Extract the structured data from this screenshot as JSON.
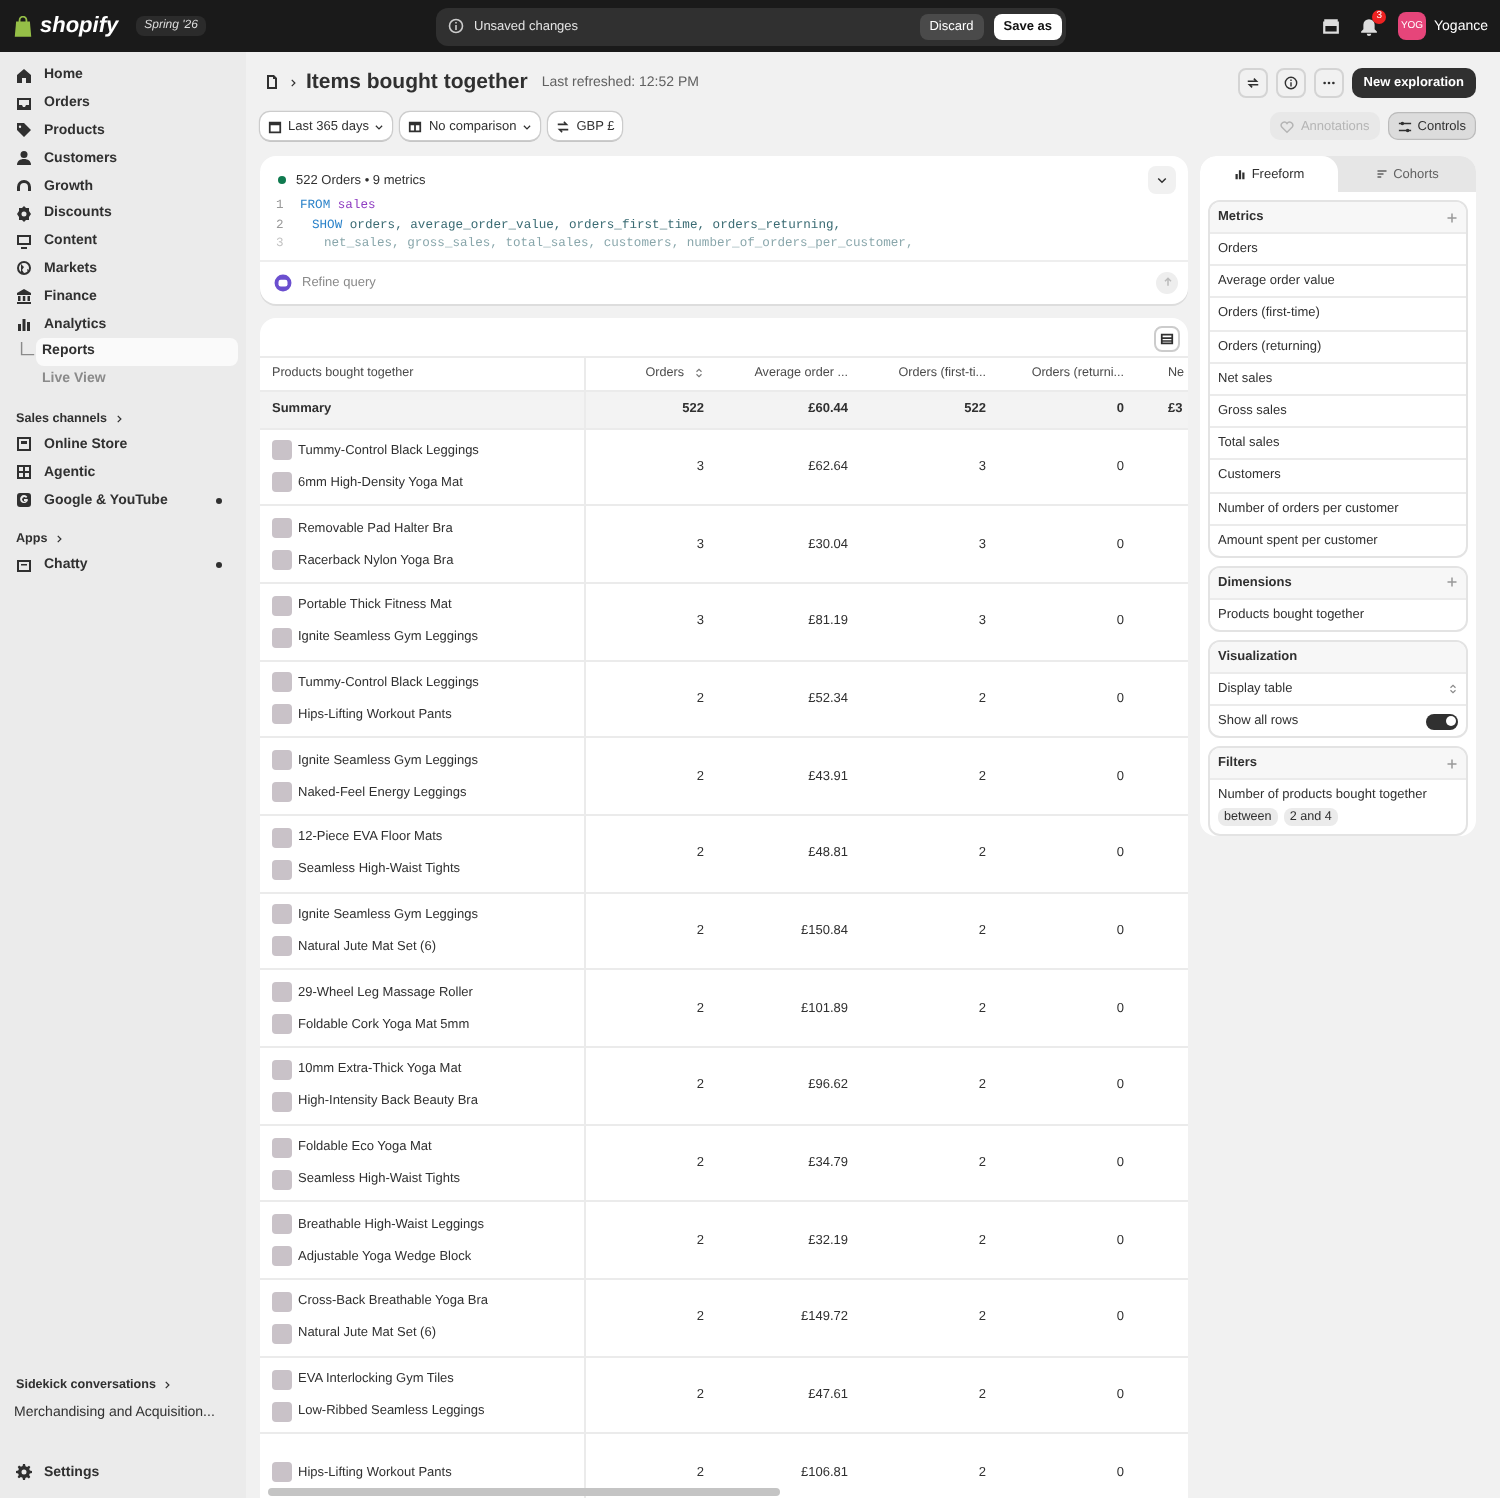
{
  "topbar": {
    "logo": "shopify",
    "edition": "Spring '26",
    "notice": "Unsaved changes",
    "discard": "Discard",
    "save": "Save as",
    "notifications": "3",
    "avatar": "YOG",
    "store": "Yogance"
  },
  "sidebar": {
    "nav": [
      {
        "label": "Home",
        "selected": false
      },
      {
        "label": "Orders",
        "selected": false
      },
      {
        "label": "Products",
        "selected": false
      },
      {
        "label": "Customers",
        "selected": false
      },
      {
        "label": "Growth",
        "selected": false
      },
      {
        "label": "Discounts",
        "selected": false
      },
      {
        "label": "Content",
        "selected": false
      },
      {
        "label": "Markets",
        "selected": false
      },
      {
        "label": "Finance",
        "selected": false
      },
      {
        "label": "Analytics",
        "selected": false,
        "children": [
          {
            "label": "Reports",
            "selected": true
          },
          {
            "label": "Live View",
            "selected": false
          }
        ]
      }
    ],
    "sections": [
      {
        "title": "Sales channels",
        "items": [
          {
            "label": "Online Store",
            "dot": false
          },
          {
            "label": "Agentic",
            "dot": false
          },
          {
            "label": "Google & YouTube",
            "dot": true
          }
        ]
      },
      {
        "title": "Apps",
        "items": [
          {
            "label": "Chatty",
            "dot": true
          }
        ]
      }
    ],
    "sidekick": {
      "title": "Sidekick conversations",
      "items": [
        "Merchandising and Acquisition..."
      ]
    },
    "settings": "Settings"
  },
  "header": {
    "title": "Items bought together",
    "refreshed": "Last refreshed: 12:52 PM",
    "primary": "New exploration",
    "filters": [
      "Last 365 days",
      "No comparison",
      "GBP £"
    ],
    "annotations": {
      "label": "Annotations",
      "disabled": true
    },
    "controls": {
      "label": "Controls",
      "selected": true
    }
  },
  "query": {
    "status": "522 Orders • 9 metrics",
    "lines": [
      {
        "number": "1",
        "faded": false,
        "tokens": [
          {
            "kind": "keyword",
            "text": "FROM"
          },
          {
            "kind": "table",
            "text": "sales"
          }
        ]
      },
      {
        "number": "2",
        "faded": false,
        "tokens": [
          {
            "kind": "keyword",
            "text": "SHOW"
          },
          {
            "kind": "plain",
            "text": "orders, average_order_value, orders_first_time, orders_returning,"
          }
        ]
      },
      {
        "number": "3",
        "faded": true,
        "tokens": [
          {
            "kind": "plain",
            "text": "net_sales, gross_sales, total_sales, customers, number_of_orders_per_customer,"
          }
        ]
      }
    ],
    "placeholder": "Refine query"
  },
  "table": {
    "columns": [
      {
        "label": "Products bought together",
        "sortable": false
      },
      {
        "label": "Orders",
        "sortable": true
      },
      {
        "label": "Average order ...",
        "sortable": false
      },
      {
        "label": "Orders (first-ti...",
        "sortable": false
      },
      {
        "label": "Orders (returni...",
        "sortable": false
      },
      {
        "label": "Ne",
        "sortable": false
      }
    ],
    "summary": [
      "Summary",
      "522",
      "£60.44",
      "522",
      "0",
      "£3"
    ],
    "rows": [
      {
        "products": [
          "Tummy-Control Black Leggings",
          "6mm High-Density Yoga Mat"
        ],
        "values": [
          "3",
          "£62.64",
          "3",
          "0"
        ]
      },
      {
        "products": [
          "Removable Pad Halter Bra",
          "Racerback Nylon Yoga Bra"
        ],
        "values": [
          "3",
          "£30.04",
          "3",
          "0"
        ]
      },
      {
        "products": [
          "Portable Thick Fitness Mat",
          "Ignite Seamless Gym Leggings"
        ],
        "values": [
          "3",
          "£81.19",
          "3",
          "0"
        ]
      },
      {
        "products": [
          "Tummy-Control Black Leggings",
          "Hips-Lifting Workout Pants"
        ],
        "values": [
          "2",
          "£52.34",
          "2",
          "0"
        ]
      },
      {
        "products": [
          "Ignite Seamless Gym Leggings",
          "Naked-Feel Energy Leggings"
        ],
        "values": [
          "2",
          "£43.91",
          "2",
          "0"
        ]
      },
      {
        "products": [
          "12-Piece EVA Floor Mats",
          "Seamless High-Waist Tights"
        ],
        "values": [
          "2",
          "£48.81",
          "2",
          "0"
        ]
      },
      {
        "products": [
          "Ignite Seamless Gym Leggings",
          "Natural Jute Mat Set (6)"
        ],
        "values": [
          "2",
          "£150.84",
          "2",
          "0"
        ]
      },
      {
        "products": [
          "29-Wheel Leg Massage Roller",
          "Foldable Cork Yoga Mat 5mm"
        ],
        "values": [
          "2",
          "£101.89",
          "2",
          "0"
        ]
      },
      {
        "products": [
          "10mm Extra-Thick Yoga Mat",
          "High-Intensity Back Beauty Bra"
        ],
        "values": [
          "2",
          "£96.62",
          "2",
          "0"
        ]
      },
      {
        "products": [
          "Foldable Eco Yoga Mat",
          "Seamless High-Waist Tights"
        ],
        "values": [
          "2",
          "£34.79",
          "2",
          "0"
        ]
      },
      {
        "products": [
          "Breathable High-Waist Leggings",
          "Adjustable Yoga Wedge Block"
        ],
        "values": [
          "2",
          "£32.19",
          "2",
          "0"
        ]
      },
      {
        "products": [
          "Cross-Back Breathable Yoga Bra",
          "Natural Jute Mat Set (6)"
        ],
        "values": [
          "2",
          "£149.72",
          "2",
          "0"
        ]
      },
      {
        "products": [
          "EVA Interlocking Gym Tiles",
          "Low-Ribbed Seamless Leggings"
        ],
        "values": [
          "2",
          "£47.61",
          "2",
          "0"
        ]
      },
      {
        "products": [
          "Hips-Lifting Workout Pants"
        ],
        "values": [
          "2",
          "£106.81",
          "2",
          "0"
        ]
      }
    ]
  },
  "panel": {
    "tabs": [
      {
        "label": "Freeform",
        "selected": true
      },
      {
        "label": "Cohorts",
        "selected": false
      }
    ],
    "sections": [
      {
        "title": "Metrics",
        "addable": true,
        "items": [
          {
            "kind": "text",
            "label": "Orders"
          },
          {
            "kind": "text",
            "label": "Average order value"
          },
          {
            "kind": "text",
            "label": "Orders (first-time)"
          },
          {
            "kind": "text",
            "label": "Orders (returning)"
          },
          {
            "kind": "text",
            "label": "Net sales"
          },
          {
            "kind": "text",
            "label": "Gross sales"
          },
          {
            "kind": "text",
            "label": "Total sales"
          },
          {
            "kind": "text",
            "label": "Customers"
          },
          {
            "kind": "text",
            "label": "Number of orders per customer"
          },
          {
            "kind": "text",
            "label": "Amount spent per customer"
          }
        ]
      },
      {
        "title": "Dimensions",
        "addable": true,
        "items": [
          {
            "kind": "text",
            "label": "Products bought together"
          }
        ]
      },
      {
        "title": "Visualization",
        "addable": false,
        "items": [
          {
            "kind": "select",
            "label": "Display table"
          },
          {
            "kind": "toggle",
            "label": "Show all rows",
            "on": true
          }
        ]
      },
      {
        "title": "Filters",
        "addable": true,
        "items": [
          {
            "kind": "filter",
            "label": "Number of products bought together",
            "chips": [
              "between",
              "2 and 4"
            ]
          }
        ]
      }
    ]
  }
}
